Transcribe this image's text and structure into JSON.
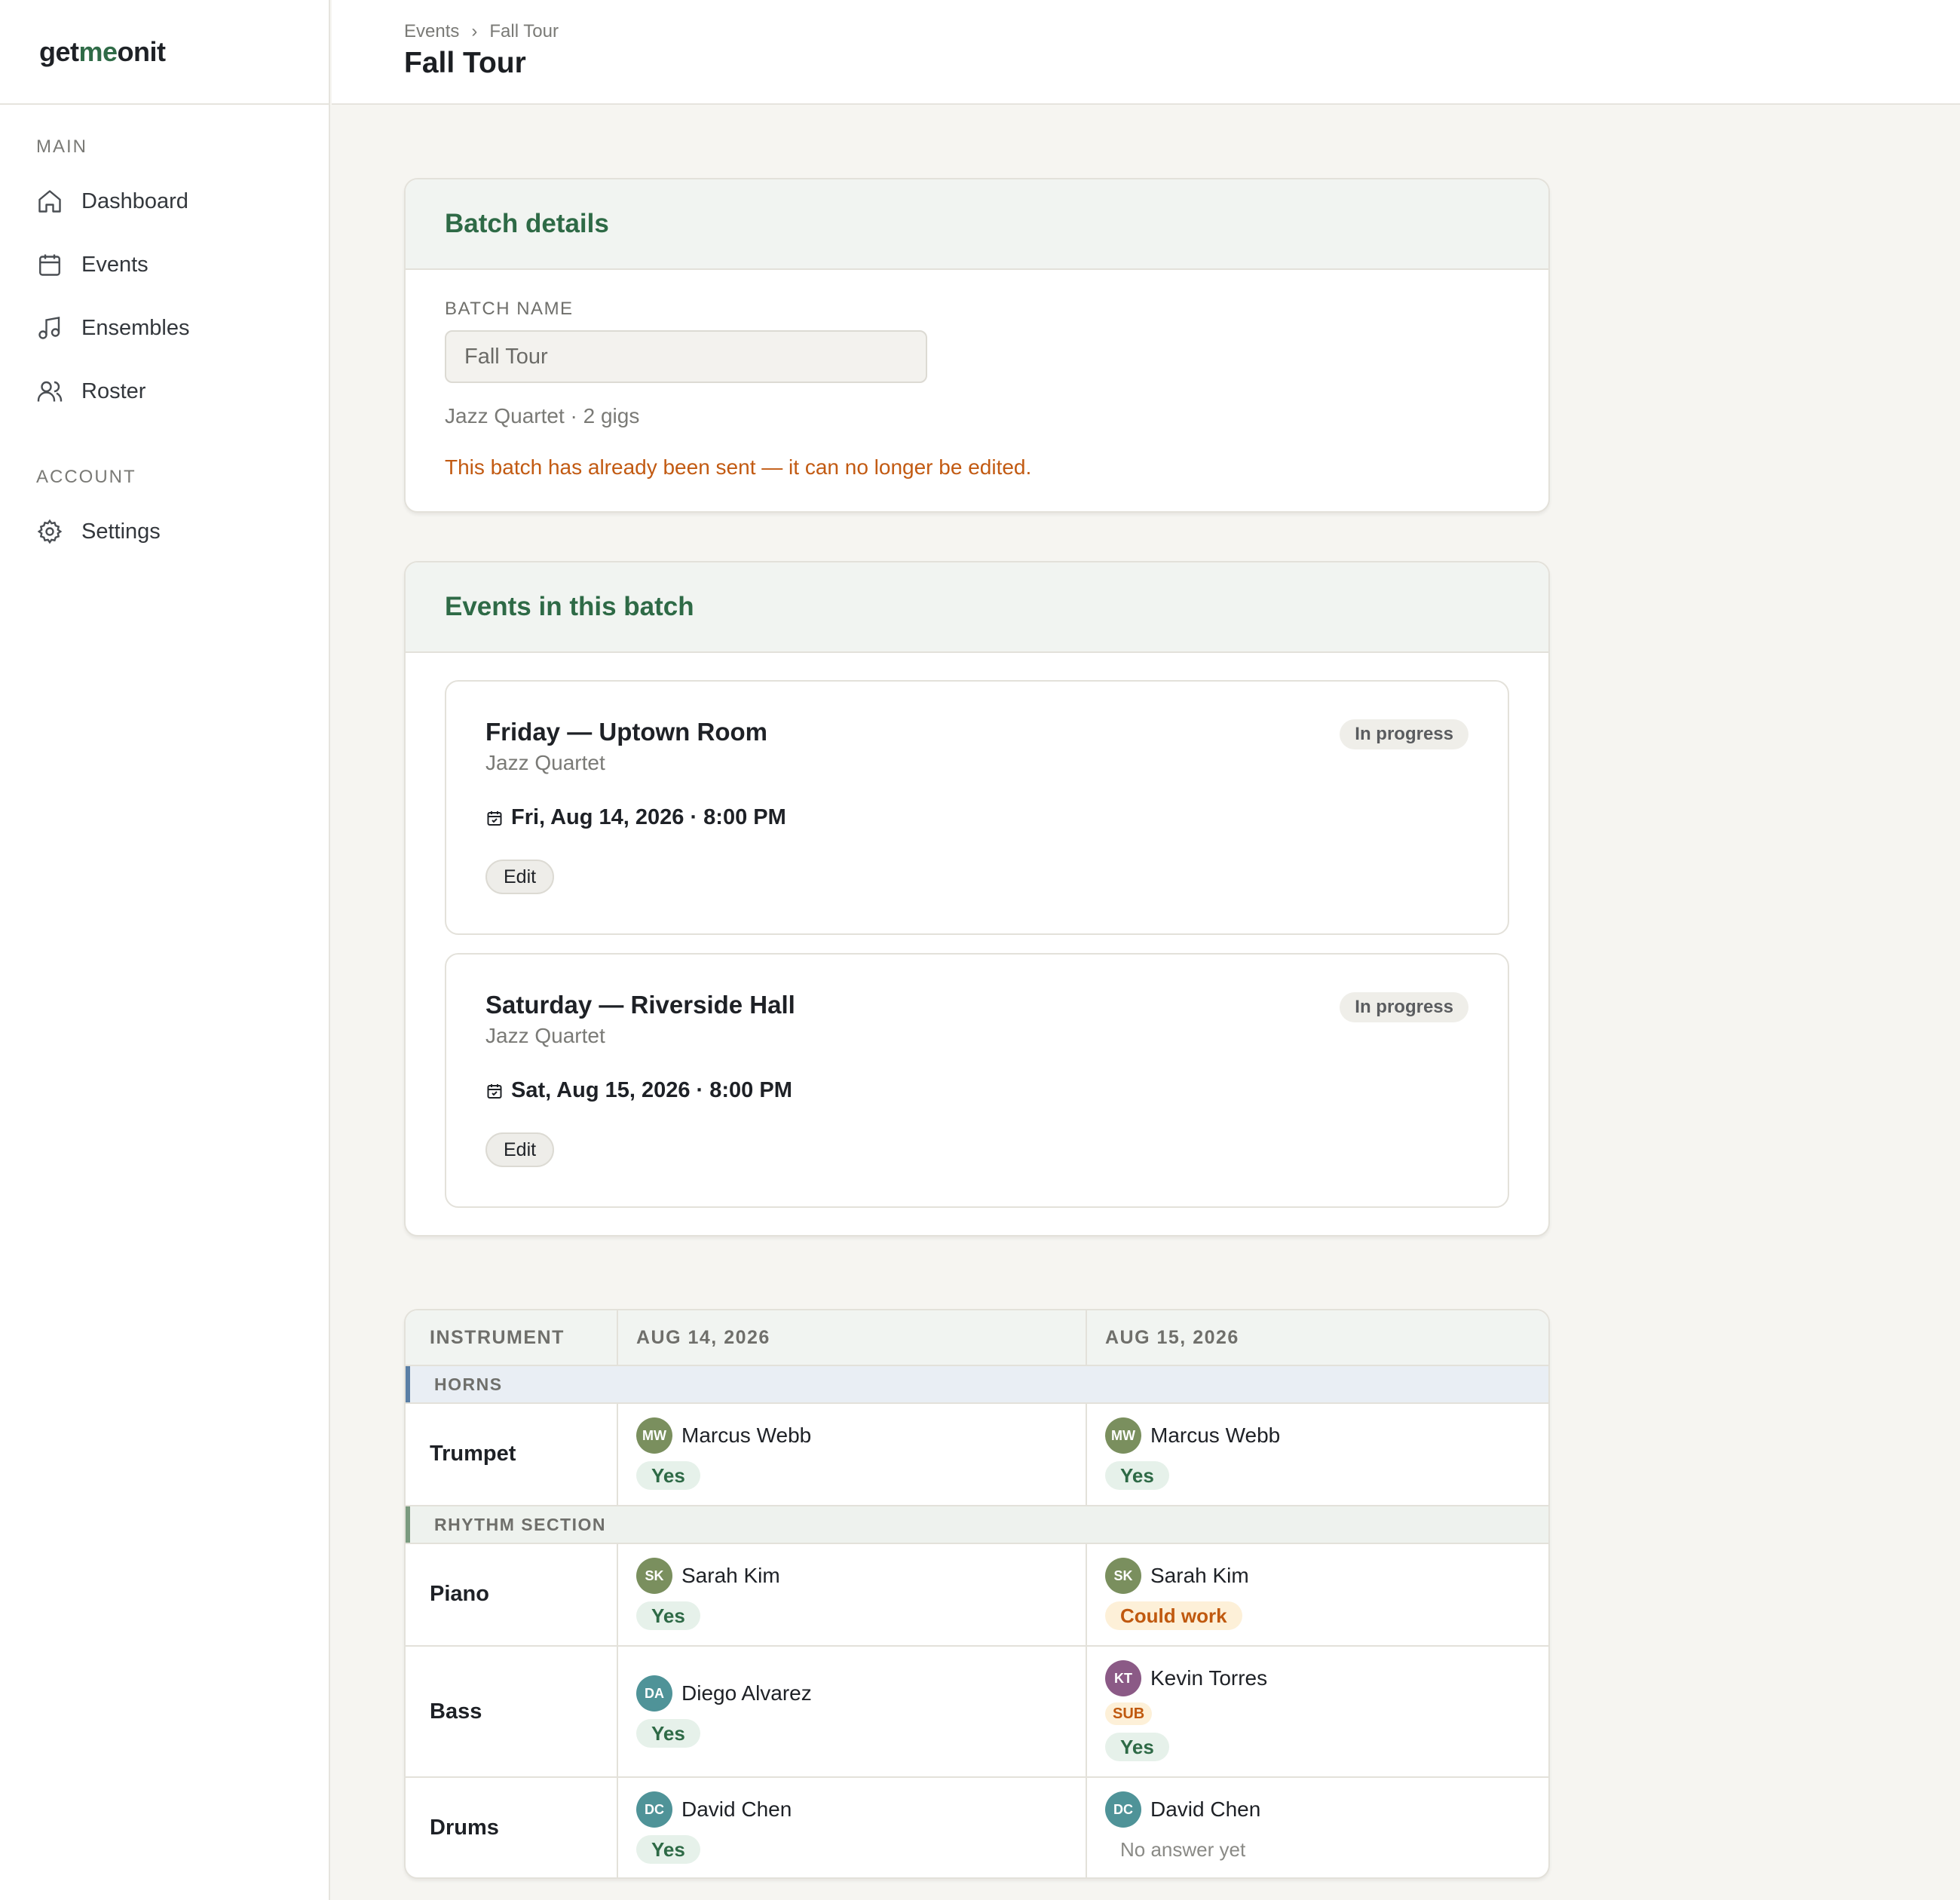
{
  "app": {
    "logo_pre": "get",
    "logo_me": "me",
    "logo_post": "onit"
  },
  "sidebar": {
    "main_heading": "MAIN",
    "account_heading": "ACCOUNT",
    "items": [
      {
        "label": "Dashboard",
        "icon": "home-icon"
      },
      {
        "label": "Events",
        "icon": "calendar-icon"
      },
      {
        "label": "Ensembles",
        "icon": "music-note-icon"
      },
      {
        "label": "Roster",
        "icon": "users-icon"
      },
      {
        "label": "Settings",
        "icon": "gear-icon"
      }
    ]
  },
  "header": {
    "breadcrumb": [
      "Events",
      "Fall Tour"
    ],
    "breadcrumb_sep": "›",
    "title": "Fall Tour"
  },
  "batch": {
    "heading": "Batch details",
    "name_label": "BATCH NAME",
    "name_value": "Fall Tour",
    "meta": "Jazz Quartet · 2 gigs",
    "warning": "This batch has already been sent — it can no longer be edited."
  },
  "events": {
    "heading": "Events in this batch",
    "items": [
      {
        "title": "Friday — Uptown Room",
        "ensemble": "Jazz Quartet",
        "date": "Fri, Aug 14, 2026 · 8:00 PM",
        "status": "In progress",
        "edit_label": "Edit"
      },
      {
        "title": "Saturday — Riverside Hall",
        "ensemble": "Jazz Quartet",
        "date": "Sat, Aug 15, 2026 · 8:00 PM",
        "status": "In progress",
        "edit_label": "Edit"
      }
    ]
  },
  "grid": {
    "columns": [
      "INSTRUMENT",
      "AUG 14, 2026",
      "AUG 15, 2026"
    ],
    "sections": [
      {
        "name": "HORNS",
        "accent": "#5a7fa6",
        "rows": [
          {
            "instrument": "Trumpet",
            "cells": [
              {
                "initials": "MW",
                "name": "Marcus Webb",
                "avatar_color": "#7a8f5e",
                "response": "Yes",
                "sub": ""
              },
              {
                "initials": "MW",
                "name": "Marcus Webb",
                "avatar_color": "#7a8f5e",
                "response": "Yes",
                "sub": ""
              }
            ]
          }
        ]
      },
      {
        "name": "RHYTHM SECTION",
        "accent": "#7a9a7f",
        "rows": [
          {
            "instrument": "Piano",
            "cells": [
              {
                "initials": "SK",
                "name": "Sarah Kim",
                "avatar_color": "#7a8f5e",
                "response": "Yes",
                "sub": ""
              },
              {
                "initials": "SK",
                "name": "Sarah Kim",
                "avatar_color": "#7a8f5e",
                "response": "Could work",
                "sub": ""
              }
            ]
          },
          {
            "instrument": "Bass",
            "cells": [
              {
                "initials": "DA",
                "name": "Diego Alvarez",
                "avatar_color": "#4f9398",
                "response": "Yes",
                "sub": ""
              },
              {
                "initials": "KT",
                "name": "Kevin Torres",
                "avatar_color": "#8b5a86",
                "response": "Yes",
                "sub": "SUB"
              }
            ]
          },
          {
            "instrument": "Drums",
            "cells": [
              {
                "initials": "DC",
                "name": "David Chen",
                "avatar_color": "#4f9398",
                "response": "Yes",
                "sub": ""
              },
              {
                "initials": "DC",
                "name": "David Chen",
                "avatar_color": "#4f9398",
                "response": "No answer yet",
                "sub": ""
              }
            ]
          }
        ]
      }
    ]
  }
}
